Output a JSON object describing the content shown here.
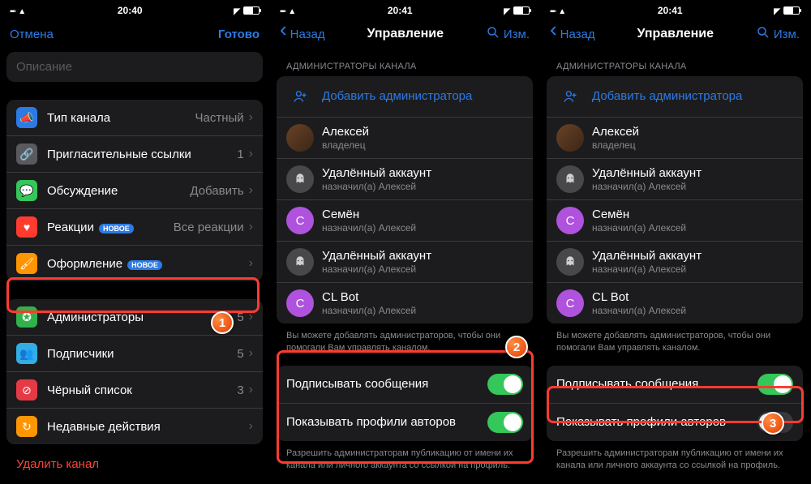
{
  "panel1": {
    "status": {
      "time": "20:40"
    },
    "nav": {
      "left": "Отмена",
      "right": "Готово"
    },
    "description_placeholder": "Описание",
    "settings1": [
      {
        "icon": "megaphone-icon",
        "color": "ic-blue",
        "glyph": "📣",
        "label": "Тип канала",
        "value": "Частный"
      },
      {
        "icon": "link-icon",
        "color": "ic-grey",
        "glyph": "🔗",
        "label": "Пригласительные ссылки",
        "value": "1"
      },
      {
        "icon": "chat-icon",
        "color": "ic-green",
        "glyph": "💬",
        "label": "Обсуждение",
        "value": "Добавить"
      },
      {
        "icon": "heart-icon",
        "color": "ic-red",
        "glyph": "♥",
        "label": "Реакции",
        "badge": "НОВОЕ",
        "value": "Все реакции"
      },
      {
        "icon": "brush-icon",
        "color": "ic-orange",
        "glyph": "🖌",
        "label": "Оформление",
        "badge": "НОВОЕ",
        "value": ""
      }
    ],
    "settings2": [
      {
        "icon": "shield-icon",
        "color": "ic-lgreen",
        "glyph": "✪",
        "label": "Администраторы",
        "value": "5"
      },
      {
        "icon": "people-icon",
        "color": "ic-teal",
        "glyph": "👥",
        "label": "Подписчики",
        "value": "5"
      },
      {
        "icon": "block-icon",
        "color": "ic-dred",
        "glyph": "⊘",
        "label": "Чёрный список",
        "value": "3"
      },
      {
        "icon": "history-icon",
        "color": "ic-orange",
        "glyph": "↻",
        "label": "Недавные действия",
        "value": ""
      }
    ],
    "delete": "Удалить канал"
  },
  "panel2": {
    "status": {
      "time": "20:41"
    },
    "nav": {
      "back": "Назад",
      "title": "Управление",
      "edit": "Изм."
    },
    "section": "АДМИНИСТРАТОРЫ КАНАЛА",
    "add": "Добавить администратора",
    "admins": [
      {
        "avatar": "photo",
        "name": "Алексей",
        "sub": "владелец"
      },
      {
        "avatar": "ghost",
        "name": "Удалённый аккаунт",
        "sub": "назначил(а) Алексей"
      },
      {
        "avatar": "C",
        "color": "av-purple",
        "name": "Семён",
        "sub": "назначил(а) Алексей"
      },
      {
        "avatar": "ghost",
        "name": "Удалённый аккаунт",
        "sub": "назначил(а) Алексей"
      },
      {
        "avatar": "C",
        "color": "av-purple",
        "name": "CL Bot",
        "sub": "назначил(а) Алексей"
      }
    ],
    "footer1": "Вы можете добавлять администраторов, чтобы они помогали Вам управлять каналом.",
    "toggles": [
      {
        "label": "Подписывать сообщения",
        "on": true
      },
      {
        "label": "Показывать профили авторов",
        "on": true
      }
    ],
    "footer2": "Разрешить администраторам публикацию от имени их канала или личного аккаунта со ссылкой на профиль."
  },
  "panel3": {
    "status": {
      "time": "20:41"
    },
    "nav": {
      "back": "Назад",
      "title": "Управление",
      "edit": "Изм."
    },
    "section": "АДМИНИСТРАТОРЫ КАНАЛА",
    "add": "Добавить администратора",
    "admins": [
      {
        "avatar": "photo",
        "name": "Алексей",
        "sub": "владелец"
      },
      {
        "avatar": "ghost",
        "name": "Удалённый аккаунт",
        "sub": "назначил(а) Алексей"
      },
      {
        "avatar": "C",
        "color": "av-purple",
        "name": "Семён",
        "sub": "назначил(а) Алексей"
      },
      {
        "avatar": "ghost",
        "name": "Удалённый аккаунт",
        "sub": "назначил(а) Алексей"
      },
      {
        "avatar": "C",
        "color": "av-purple",
        "name": "CL Bot",
        "sub": "назначил(а) Алексей"
      }
    ],
    "footer1": "Вы можете добавлять администраторов, чтобы они помогали Вам управлять каналом.",
    "toggles": [
      {
        "label": "Подписывать сообщения",
        "on": true
      },
      {
        "label": "Показывать профили авторов",
        "on": false
      }
    ],
    "footer2": "Разрешить администраторам публикацию от имени их канала или личного аккаунта со ссылкой на профиль."
  },
  "steps": {
    "1": "1",
    "2": "2",
    "3": "3"
  }
}
